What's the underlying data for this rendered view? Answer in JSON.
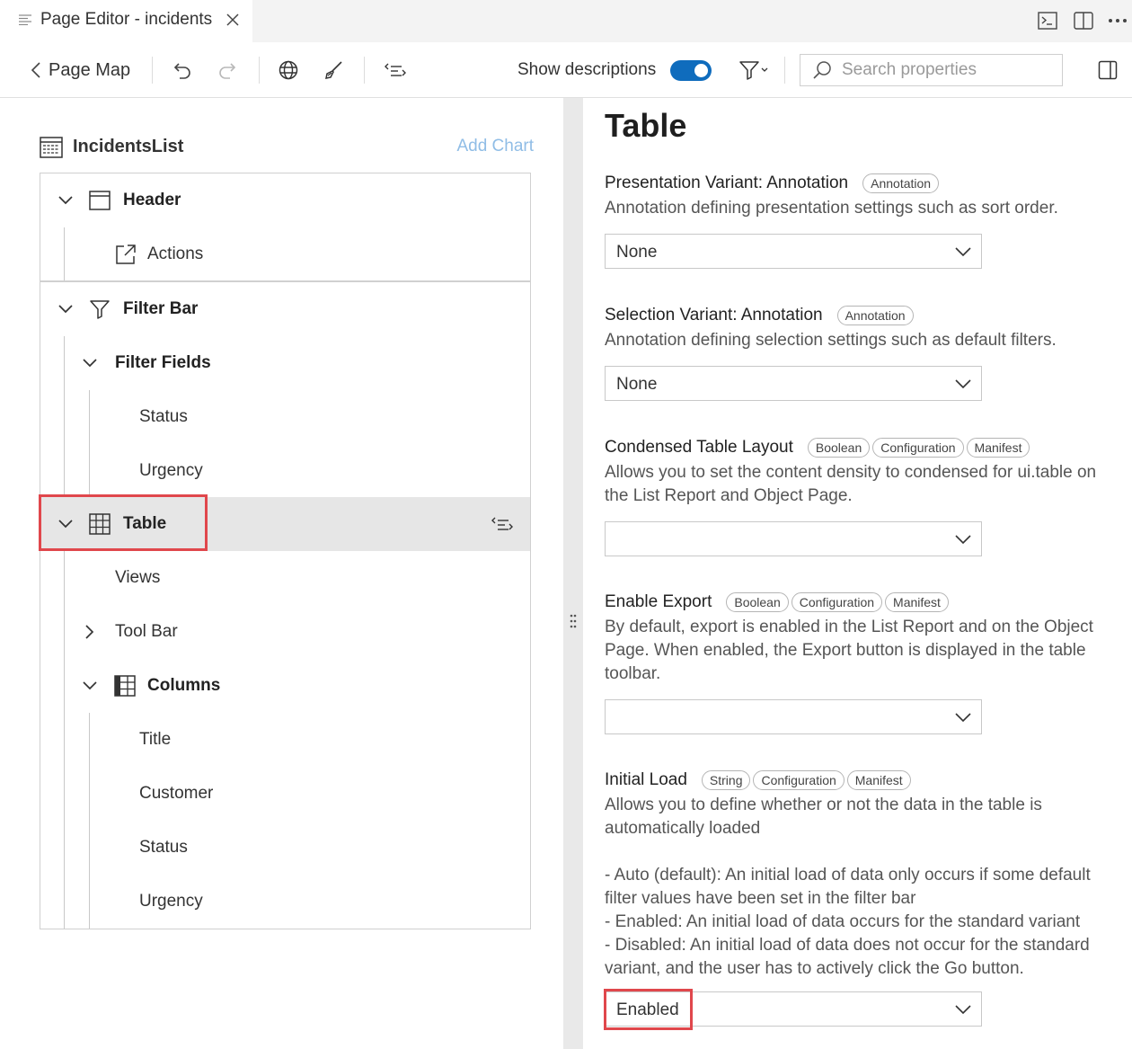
{
  "tab": {
    "title": "Page Editor - incidents",
    "menu_icon": "menu-lines-icon",
    "close_icon": "close-icon"
  },
  "tabbar_actions": [
    "terminal-icon",
    "split-editor-icon",
    "more-icon"
  ],
  "toolbar": {
    "page_map_label": "Page Map",
    "show_descriptions_label": "Show descriptions",
    "show_descriptions_on": true,
    "search_placeholder": "Search properties",
    "accent": "#0f6cbd"
  },
  "left": {
    "list_title": "IncidentsList",
    "add_chart": "Add Chart",
    "tree": {
      "header": "Header",
      "actions": "Actions",
      "filter_bar": "Filter Bar",
      "filter_fields": "Filter Fields",
      "filter_status": "Status",
      "filter_urgency": "Urgency",
      "table": "Table",
      "views": "Views",
      "tool_bar": "Tool Bar",
      "columns": "Columns",
      "col_title": "Title",
      "col_customer": "Customer",
      "col_status": "Status",
      "col_urgency": "Urgency"
    }
  },
  "right": {
    "title": "Table",
    "props": [
      {
        "name": "Presentation Variant: Annotation",
        "badges": [
          "Annotation"
        ],
        "description": "Annotation defining presentation settings such as sort order.",
        "value": "None"
      },
      {
        "name": "Selection Variant: Annotation",
        "badges": [
          "Annotation"
        ],
        "description": "Annotation defining selection settings such as default filters.",
        "value": "None"
      },
      {
        "name": "Condensed Table Layout",
        "badges": [
          "Boolean",
          "Configuration",
          "Manifest"
        ],
        "description": "Allows you to set the content density to condensed for ui.table on the List Report and Object Page.",
        "value": ""
      },
      {
        "name": "Enable Export",
        "badges": [
          "Boolean",
          "Configuration",
          "Manifest"
        ],
        "description": "By default, export is enabled in the List Report and on the Object Page. When enabled, the Export button is displayed in the table toolbar.",
        "value": ""
      },
      {
        "name": "Initial Load",
        "badges": [
          "String",
          "Configuration",
          "Manifest"
        ],
        "description": "Allows you to define whether or not the data in the table is automatically loaded\n\n- Auto (default): An initial load of data only occurs if some default filter values have been set in the filter bar\n- Enabled: An initial load of data occurs for the standard variant\n- Disabled: An initial load of data does not occur for the standard variant, and the user has to actively click the Go button.",
        "value": "Enabled"
      }
    ]
  },
  "highlight_color": "#e0474c"
}
